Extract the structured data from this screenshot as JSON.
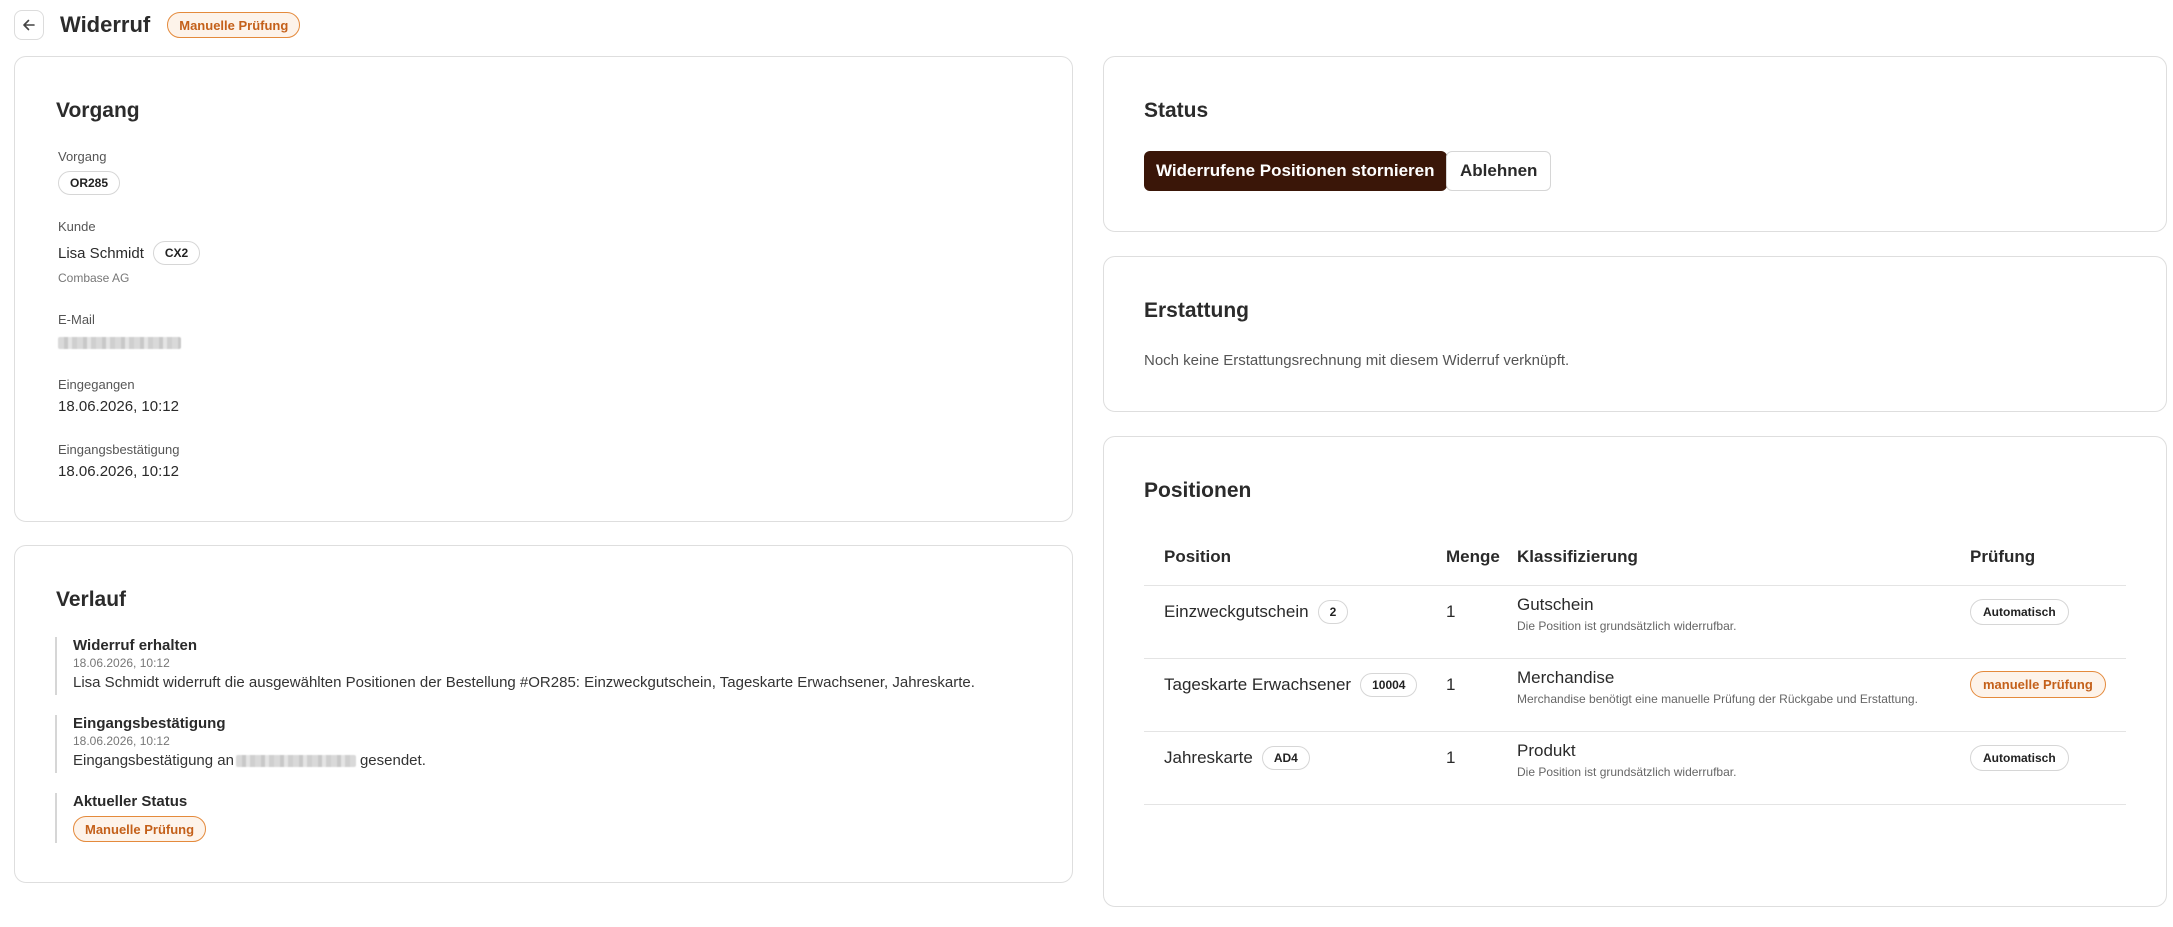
{
  "header": {
    "title": "Widerruf",
    "status_badge": "Manuelle Prüfung"
  },
  "vorgang_card": {
    "title": "Vorgang",
    "vorgang_label": "Vorgang",
    "vorgang_id": "OR285",
    "kunde_label": "Kunde",
    "kunde_name": "Lisa Schmidt",
    "kunde_id": "CX2",
    "kunde_company": "Combase AG",
    "email_label": "E-Mail",
    "eingegangen_label": "Eingegangen",
    "eingegangen_value": "18.06.2026, 10:12",
    "bestaetigung_label": "Eingangsbestätigung",
    "bestaetigung_value": "18.06.2026, 10:12"
  },
  "verlauf_card": {
    "title": "Verlauf",
    "items": [
      {
        "title": "Widerruf erhalten",
        "date": "18.06.2026, 10:12",
        "text": "Lisa Schmidt widerruft die ausgewählten Positionen der Bestellung #OR285: Einzweckgutschein, Tageskarte Erwachsener, Jahreskarte."
      },
      {
        "title": "Eingangsbestätigung",
        "date": "18.06.2026, 10:12",
        "text_before": "Eingangsbestätigung an",
        "text_after": "gesendet."
      },
      {
        "title": "Aktueller Status",
        "badge": "Manuelle Prüfung"
      }
    ]
  },
  "status_card": {
    "title": "Status",
    "primary_button": "Widerrufene Positionen stornieren",
    "secondary_button": "Ablehnen"
  },
  "erstattung_card": {
    "title": "Erstattung",
    "text": "Noch keine Erstattungsrechnung mit diesem Widerruf verknüpft."
  },
  "positionen_card": {
    "title": "Positionen",
    "columns": [
      "Position",
      "Menge",
      "Klassifizierung",
      "Prüfung"
    ],
    "rows": [
      {
        "position": "Einzweckgutschein",
        "code": "2",
        "menge": "1",
        "klasse": "Gutschein",
        "beschreibung": "Die Position ist grundsätzlich widerrufbar.",
        "pruefung": "Automatisch"
      },
      {
        "position": "Tageskarte Erwachsener",
        "code": "10004",
        "menge": "1",
        "klasse": "Merchandise",
        "beschreibung": "Merchandise benötigt eine manuelle Prüfung der Rückgabe und Erstattung.",
        "pruefung": "manuelle Prüfung"
      },
      {
        "position": "Jahreskarte",
        "code": "AD4",
        "menge": "1",
        "klasse": "Produkt",
        "beschreibung": "Die Position ist grundsätzlich widerrufbar.",
        "pruefung": "Automatisch"
      }
    ]
  },
  "colors": {
    "accent_dark": "#3a1608",
    "warning_border": "#e48a3c",
    "warning_text": "#c4601a",
    "warning_bg": "#fdf3ea"
  }
}
